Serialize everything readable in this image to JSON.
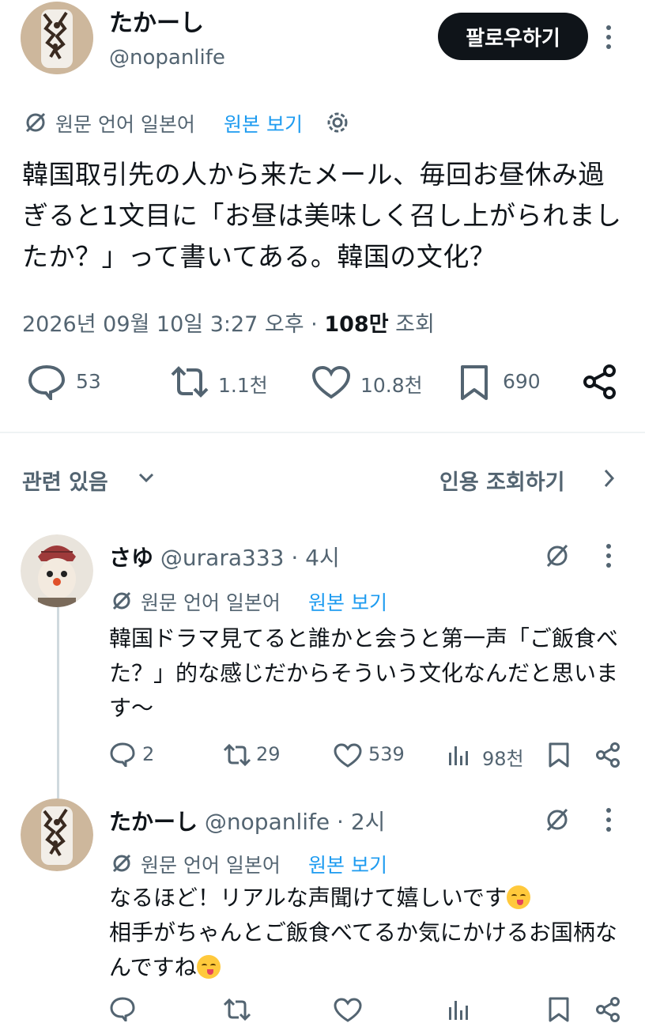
{
  "tweet": {
    "author_name": "たかーし",
    "author_handle": "@nopanlife",
    "follow_label": "팔로우하기",
    "translate_note": "원문 언어 일본어",
    "view_original": "원본 보기",
    "text": "韓国取引先の人から来たメール、毎回お昼休み過ぎると1文目に「お昼は美味しく召し上がられましたか？」って書いてある。韓国の文化？",
    "timestamp": "2026년 09월 10일 3:27 오후 · ",
    "views_count": "108만",
    "views_label": "조회",
    "replies": "53",
    "reposts": "1.1천",
    "likes": "10.8천",
    "bookmarks": "690"
  },
  "related": {
    "label": "관련 있음",
    "quotes_label": "인용 조회하기"
  },
  "replies": [
    {
      "name": "さゆ",
      "handle": "@urara333",
      "time": "· 4시",
      "translate_note": "원문 언어 일본어",
      "view_original": "원본 보기",
      "text": "韓国ドラマ見てると誰かと会うと第一声「ご飯食べた？」的な感じだからそういう文化なんだと思います〜",
      "replies": "2",
      "reposts": "29",
      "likes": "539",
      "views": "98천"
    },
    {
      "name": "たかーし",
      "handle": "@nopanlife",
      "time": "· 2시",
      "translate_note": "원문 언어 일본어",
      "view_original": "원본 보기",
      "line1": "なるほど！リアルな声聞けて嬉しいです",
      "line2": "相手がちゃんとご飯食べてるか気にかけるお国柄なんですね"
    }
  ],
  "icons": {
    "translate": "translate-off-icon",
    "settings": "gear-icon",
    "more": "more-vertical-icon",
    "reply": "reply-icon",
    "repost": "repost-icon",
    "like": "heart-icon",
    "bookmark": "bookmark-icon",
    "share": "share-icon",
    "views": "views-icon",
    "chevron_down": "chevron-down-icon",
    "chevron_right": "chevron-right-icon"
  },
  "colors": {
    "link": "#1d9bf0",
    "muted": "#536471",
    "button_bg": "#0f1419"
  }
}
